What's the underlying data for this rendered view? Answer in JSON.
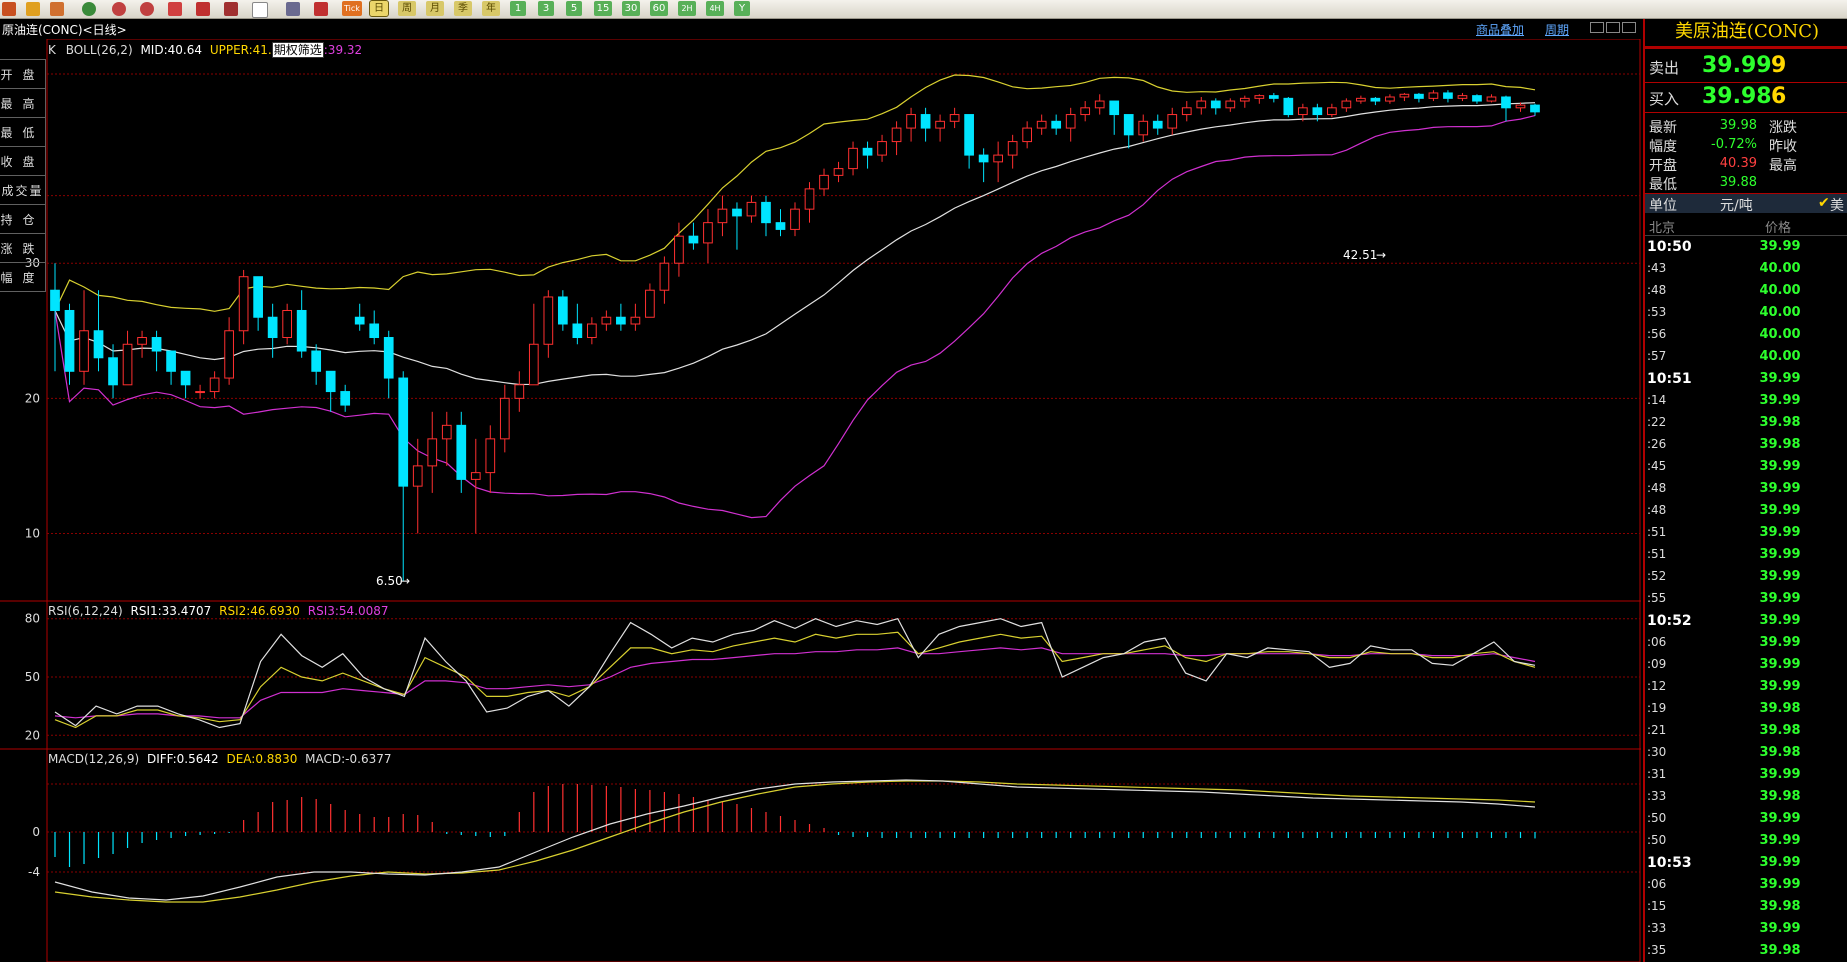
{
  "toolbar": {
    "period_buttons": [
      "日",
      "周",
      "月",
      "季",
      "年"
    ],
    "minute_buttons": [
      "1",
      "3",
      "5",
      "15",
      "30",
      "60",
      "2H",
      "4H",
      "Y"
    ],
    "tick_label": "Tick"
  },
  "header": {
    "title": "原油连(CONC)<日线>",
    "overlay_link": "商品叠加",
    "cycle_link": "周期"
  },
  "main_chart": {
    "legend": {
      "name": "K",
      "boll": "BOLL(26,2)",
      "mid": "MID:40.64",
      "upper": "UPPER:41.",
      "filter_btn": "期权筛选",
      "lower": ":39.32"
    },
    "y_ticks": [
      "30",
      "20",
      "10"
    ],
    "low_annotation": "6.50",
    "high_annotation": "42.51"
  },
  "rsi_chart": {
    "legend": {
      "name": "RSI(6,12,24)",
      "rsi1": "RSI1:33.4707",
      "rsi2": "RSI2:46.6930",
      "rsi3": "RSI3:54.0087"
    },
    "y_ticks": [
      "80",
      "50",
      "20"
    ]
  },
  "macd_chart": {
    "legend": {
      "name": "MACD(12,26,9)",
      "diff": "DIFF:0.5642",
      "dea": "DEA:0.8830",
      "macd": "MACD:-0.6377"
    },
    "y_ticks": [
      "0",
      "-4"
    ]
  },
  "left_info": [
    "开盘",
    "最高",
    "最低",
    "收盘",
    "成交量",
    "持仓",
    "涨跌",
    "幅度"
  ],
  "right_panel": {
    "title": "美原油连(CONC)",
    "sell": {
      "label": "卖出",
      "price": "39.99",
      "vol": "9"
    },
    "buy": {
      "label": "买入",
      "price": "39.98",
      "vol": "6"
    },
    "stats": [
      {
        "label": "最新",
        "value": "39.98",
        "label2": "涨跌",
        "color": "#2dff2d"
      },
      {
        "label": "幅度",
        "value": "-0.72%",
        "label2": "昨收",
        "color": "#2dff2d"
      },
      {
        "label": "开盘",
        "value": "40.39",
        "label2": "最高",
        "color": "#ff4040"
      },
      {
        "label": "最低",
        "value": "39.88",
        "label2": "",
        "color": "#2dff2d"
      }
    ],
    "unit_label": "单位",
    "unit_value": "元/吨",
    "unit_check": "美",
    "col_time": "北京",
    "col_price": "价格",
    "ticks": [
      {
        "t": "10:50",
        "p": "39.99",
        "big": true
      },
      {
        "t": ":43",
        "p": "40.00"
      },
      {
        "t": ":48",
        "p": "40.00"
      },
      {
        "t": ":53",
        "p": "40.00"
      },
      {
        "t": ":56",
        "p": "40.00"
      },
      {
        "t": ":57",
        "p": "40.00"
      },
      {
        "t": "10:51",
        "p": "39.99",
        "big": true
      },
      {
        "t": ":14",
        "p": "39.99"
      },
      {
        "t": ":22",
        "p": "39.98"
      },
      {
        "t": ":26",
        "p": "39.98"
      },
      {
        "t": ":45",
        "p": "39.99"
      },
      {
        "t": ":48",
        "p": "39.99"
      },
      {
        "t": ":48",
        "p": "39.99"
      },
      {
        "t": ":51",
        "p": "39.99"
      },
      {
        "t": ":51",
        "p": "39.99"
      },
      {
        "t": ":52",
        "p": "39.99"
      },
      {
        "t": ":55",
        "p": "39.99"
      },
      {
        "t": "10:52",
        "p": "39.99",
        "big": true
      },
      {
        "t": ":06",
        "p": "39.99"
      },
      {
        "t": ":09",
        "p": "39.99"
      },
      {
        "t": ":12",
        "p": "39.99"
      },
      {
        "t": ":19",
        "p": "39.98"
      },
      {
        "t": ":21",
        "p": "39.98"
      },
      {
        "t": ":30",
        "p": "39.98"
      },
      {
        "t": ":31",
        "p": "39.99"
      },
      {
        "t": ":33",
        "p": "39.98"
      },
      {
        "t": ":50",
        "p": "39.99"
      },
      {
        "t": ":50",
        "p": "39.99"
      },
      {
        "t": "10:53",
        "p": "39.99",
        "big": true
      },
      {
        "t": ":06",
        "p": "39.99"
      },
      {
        "t": ":15",
        "p": "39.98"
      },
      {
        "t": ":33",
        "p": "39.99"
      },
      {
        "t": ":35",
        "p": "39.98"
      }
    ]
  },
  "colors": {
    "up": "#ff3030",
    "down": "#00e5ff",
    "upper": "#d8d030",
    "mid": "#e0e0e0",
    "lower": "#d030d0",
    "grid": "#8a0000"
  },
  "chart_data": {
    "type": "candlestick",
    "ylim": [
      5,
      46
    ],
    "candles": [
      [
        28,
        26.5,
        30,
        22
      ],
      [
        26.5,
        22,
        27,
        21
      ],
      [
        22,
        25,
        28,
        21
      ],
      [
        25,
        23,
        28,
        22
      ],
      [
        23,
        21,
        24,
        20
      ],
      [
        21,
        24,
        25,
        21
      ],
      [
        24,
        24.5,
        25,
        23
      ],
      [
        24.5,
        23.5,
        25,
        22
      ],
      [
        23.5,
        22,
        23.5,
        21
      ],
      [
        22,
        21,
        22,
        20
      ],
      [
        20.5,
        20.5,
        21,
        20
      ],
      [
        20.5,
        21.5,
        22,
        20
      ],
      [
        21.5,
        25,
        26,
        21
      ],
      [
        25,
        29,
        29.5,
        24
      ],
      [
        29,
        26,
        29,
        25
      ],
      [
        26,
        24.5,
        27,
        23
      ],
      [
        24.5,
        26.5,
        27,
        24
      ],
      [
        26.5,
        23.5,
        28,
        23
      ],
      [
        23.5,
        22,
        24,
        21
      ],
      [
        22,
        20.5,
        22,
        19
      ],
      [
        20.5,
        19.5,
        21,
        19
      ],
      [
        26,
        25.5,
        27,
        25
      ],
      [
        25.5,
        24.5,
        26.5,
        24
      ],
      [
        24.5,
        21.5,
        25,
        20
      ],
      [
        21.5,
        13.5,
        22,
        6.5
      ],
      [
        13.5,
        15,
        17,
        10
      ],
      [
        15,
        17,
        19,
        13
      ],
      [
        17,
        18,
        19,
        15
      ],
      [
        18,
        14,
        19,
        13
      ],
      [
        14,
        14.5,
        17,
        10
      ],
      [
        14.5,
        17,
        18,
        13
      ],
      [
        17,
        20,
        21,
        16
      ],
      [
        20,
        21,
        22,
        19
      ],
      [
        21,
        24,
        27,
        21
      ],
      [
        24,
        27.5,
        28,
        23
      ],
      [
        27.5,
        25.5,
        28,
        25
      ],
      [
        25.5,
        24.5,
        27,
        24
      ],
      [
        24.5,
        25.5,
        26,
        24
      ],
      [
        25.5,
        26,
        26.5,
        25
      ],
      [
        26,
        25.5,
        27,
        25
      ],
      [
        25.5,
        26,
        27,
        25
      ],
      [
        26,
        28,
        28.5,
        26
      ],
      [
        28,
        30,
        30.5,
        27
      ],
      [
        30,
        32,
        33,
        29
      ],
      [
        32,
        31.5,
        33,
        31
      ],
      [
        31.5,
        33,
        34,
        30
      ],
      [
        33,
        34,
        35,
        32
      ],
      [
        34,
        33.5,
        34.5,
        31
      ],
      [
        33.5,
        34.5,
        35,
        33
      ],
      [
        34.5,
        33,
        35,
        32
      ],
      [
        33,
        32.5,
        34,
        32
      ],
      [
        32.5,
        34,
        34.5,
        32
      ],
      [
        34,
        35.5,
        36,
        33
      ],
      [
        35.5,
        36.5,
        37,
        35
      ],
      [
        36.5,
        37,
        37.5,
        36
      ],
      [
        37,
        38.5,
        39,
        36.5
      ],
      [
        38.5,
        38,
        39,
        37
      ],
      [
        38,
        39,
        39.5,
        37.5
      ],
      [
        39,
        40,
        40.5,
        38
      ],
      [
        40,
        41,
        41.5,
        39
      ],
      [
        41,
        40,
        41.5,
        39
      ],
      [
        40,
        40.5,
        41,
        39
      ],
      [
        40.5,
        41,
        41.5,
        40
      ],
      [
        41,
        38,
        41,
        37
      ],
      [
        38,
        37.5,
        38.5,
        36
      ],
      [
        37.5,
        38,
        39,
        36
      ],
      [
        38,
        39,
        39.5,
        37
      ],
      [
        39,
        40,
        40.5,
        38.5
      ],
      [
        40,
        40.5,
        41,
        39.5
      ],
      [
        40.5,
        40,
        41,
        39.5
      ],
      [
        40,
        41,
        41.5,
        39
      ],
      [
        41,
        41.5,
        42,
        40.5
      ],
      [
        41.5,
        42,
        42.5,
        41
      ],
      [
        42,
        41,
        42,
        39.5
      ],
      [
        41,
        39.5,
        41,
        38.5
      ],
      [
        39.5,
        40.5,
        41,
        39
      ],
      [
        40.5,
        40,
        41,
        39.5
      ],
      [
        40,
        41,
        41.5,
        39.5
      ],
      [
        41,
        41.5,
        42,
        40.5
      ],
      [
        41.5,
        42,
        42.3,
        41
      ],
      [
        42,
        41.5,
        42.2,
        41
      ],
      [
        41.5,
        42,
        42.2,
        41.2
      ],
      [
        42,
        42.2,
        42.4,
        41.5
      ],
      [
        42.2,
        42.4,
        42.5,
        41.8
      ],
      [
        42.4,
        42.2,
        42.6,
        41.9
      ],
      [
        42.2,
        41,
        42.3,
        40.8
      ],
      [
        41,
        41.5,
        41.8,
        40.5
      ],
      [
        41.5,
        41,
        41.8,
        40.5
      ],
      [
        41,
        41.5,
        41.8,
        40.8
      ],
      [
        41.5,
        42,
        42.2,
        41.2
      ],
      [
        42,
        42.2,
        42.4,
        41.8
      ],
      [
        42.2,
        42,
        42.3,
        41.7
      ],
      [
        42,
        42.3,
        42.5,
        41.8
      ],
      [
        42.3,
        42.5,
        42.6,
        42
      ],
      [
        42.5,
        42.2,
        42.6,
        41.9
      ],
      [
        42.2,
        42.6,
        42.8,
        42
      ],
      [
        42.6,
        42.2,
        42.8,
        41.9
      ],
      [
        42.2,
        42.4,
        42.6,
        42
      ],
      [
        42.4,
        42,
        42.5,
        41.8
      ],
      [
        42,
        42.3,
        42.5,
        41.9
      ],
      [
        42.3,
        41.5,
        42.4,
        40.5
      ],
      [
        41.5,
        41.7,
        41.9,
        41.2
      ],
      [
        41.7,
        41.2,
        41.8,
        40.9
      ]
    ],
    "rsi1": [
      32,
      25,
      35,
      31,
      35,
      35,
      31,
      28,
      24,
      26,
      58,
      72,
      61,
      55,
      62,
      50,
      44,
      40,
      70,
      58,
      48,
      32,
      34,
      40,
      43,
      35,
      45,
      62,
      78,
      72,
      65,
      70,
      68,
      72,
      74,
      79,
      75,
      80,
      76,
      79,
      77,
      80,
      60,
      72,
      76,
      78,
      80,
      76,
      78,
      50,
      55,
      60,
      62,
      68,
      70,
      52,
      48,
      62,
      60,
      65,
      64,
      63,
      55,
      57,
      66,
      64,
      64,
      57,
      56,
      62,
      68,
      58,
      56
    ],
    "rsi2": [
      28,
      24,
      30,
      30,
      33,
      33,
      30,
      29,
      27,
      28,
      45,
      55,
      50,
      48,
      52,
      48,
      44,
      41,
      60,
      55,
      50,
      40,
      40,
      42,
      43,
      40,
      45,
      55,
      65,
      65,
      62,
      64,
      63,
      66,
      68,
      70,
      68,
      72,
      70,
      72,
      72,
      73,
      62,
      65,
      68,
      70,
      72,
      70,
      71,
      58,
      60,
      62,
      62,
      64,
      66,
      60,
      58,
      62,
      62,
      63,
      63,
      62,
      60,
      60,
      63,
      62,
      62,
      60,
      60,
      62,
      63,
      58,
      55
    ],
    "rsi3": [
      30,
      29,
      30,
      30,
      31,
      31,
      30,
      30,
      29,
      29,
      38,
      42,
      42,
      42,
      44,
      43,
      42,
      41,
      48,
      48,
      47,
      44,
      44,
      45,
      46,
      45,
      46,
      50,
      55,
      57,
      58,
      59,
      59,
      60,
      61,
      62,
      62,
      63,
      63,
      64,
      64,
      65,
      62,
      62,
      63,
      64,
      65,
      64,
      65,
      62,
      62,
      62,
      62,
      62,
      62,
      61,
      61,
      62,
      62,
      62,
      62,
      62,
      61,
      61,
      62,
      62,
      62,
      61,
      61,
      61,
      62,
      60,
      58
    ],
    "diff": [
      -5,
      -6,
      -6.6,
      -6.8,
      -6.4,
      -5.5,
      -4.5,
      -4,
      -4,
      -4.2,
      -4.3,
      -4,
      -3.5,
      -2,
      -0.5,
      0.8,
      1.8,
      2.6,
      3.5,
      4.3,
      4.8,
      5,
      5.1,
      5.2,
      5.1,
      4.8,
      4.5,
      4.4,
      4.3,
      4.2,
      4.1,
      4,
      3.8,
      3.6,
      3.4,
      3.3,
      3.2,
      3.1,
      3,
      2.8,
      2.5
    ],
    "dea": [
      -6,
      -6.5,
      -6.8,
      -7,
      -7,
      -6.5,
      -5.8,
      -5,
      -4.4,
      -4,
      -4.2,
      -4.1,
      -3.8,
      -2.9,
      -1.8,
      -0.5,
      0.8,
      2,
      3,
      3.8,
      4.5,
      4.8,
      5,
      5.1,
      5.1,
      5,
      4.8,
      4.7,
      4.6,
      4.5,
      4.4,
      4.3,
      4.2,
      4,
      3.8,
      3.6,
      3.5,
      3.4,
      3.3,
      3.2,
      3.0
    ],
    "macd": [
      -2.5,
      -3.5,
      -3.2,
      -2.6,
      -2.2,
      -1.6,
      -1.1,
      -0.8,
      -0.6,
      -0.4,
      -0.3,
      -0.2,
      -0.1,
      1.2,
      2,
      3,
      3.2,
      3.5,
      3.3,
      2.8,
      2.2,
      1.8,
      1.5,
      1.5,
      1.8,
      1.7,
      1,
      -0.2,
      -0.3,
      -0.4,
      -0.5,
      -0.4,
      2,
      4,
      4.6,
      4.8,
      4.8,
      4.7,
      4.6,
      4.5,
      4.3,
      4.2,
      4.0,
      3.8,
      3.5,
      3.2,
      3,
      2.8,
      2.4,
      2,
      1.6,
      1.2,
      0.8,
      0.4,
      -0.3,
      -0.5,
      -0.5,
      -0.6,
      -0.6,
      -0.6,
      -0.6,
      -0.6,
      -0.6,
      -0.6,
      -0.6,
      -0.6,
      -0.6,
      -0.6,
      -0.6,
      -0.6,
      -0.6,
      -0.6,
      -0.6,
      -0.6,
      -0.6,
      -0.6,
      -0.6,
      -0.6,
      -0.6,
      -0.6,
      -0.6,
      -0.6,
      -0.6,
      -0.6,
      -0.6,
      -0.6,
      -0.6,
      -0.6,
      -0.6,
      -0.6,
      -0.6,
      -0.6,
      -0.6,
      -0.6,
      -0.6,
      -0.6,
      -0.6,
      -0.6,
      -0.6,
      -0.6,
      -0.6,
      -0.6,
      -0.64
    ]
  }
}
